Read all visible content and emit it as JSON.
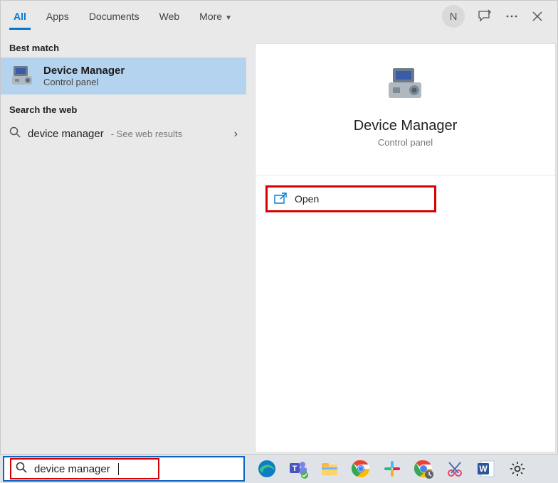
{
  "tabs": {
    "all": "All",
    "apps": "Apps",
    "documents": "Documents",
    "web": "Web",
    "more": "More"
  },
  "topright": {
    "avatar_letter": "N"
  },
  "sections": {
    "best_match": "Best match",
    "search_web": "Search the web"
  },
  "best_match": {
    "title": "Device Manager",
    "subtitle": "Control panel"
  },
  "web_result": {
    "term": "device manager",
    "hint": " - See web results"
  },
  "hero": {
    "title": "Device Manager",
    "subtitle": "Control panel"
  },
  "actions": {
    "open": "Open"
  },
  "search_input": {
    "value": "device manager"
  }
}
